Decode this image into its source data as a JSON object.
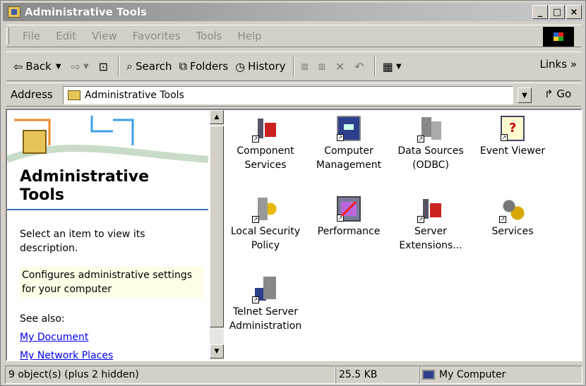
{
  "window": {
    "title": "Administrative Tools",
    "controls": [
      "_",
      "□",
      "×"
    ]
  },
  "menu": [
    "File",
    "Edit",
    "View",
    "Favorites",
    "Tools",
    "Help"
  ],
  "toolbar": {
    "back": "Back",
    "search": "Search",
    "folders": "Folders",
    "history": "History",
    "links": "Links"
  },
  "address": {
    "label": "Address",
    "value": "Administrative Tools",
    "go": "Go"
  },
  "left_pane": {
    "heading_line1": "Administrative",
    "heading_line2": "Tools",
    "desc_line1": "Select an item to view its",
    "desc_line2": "description.",
    "config_line1": "Configures administrative settings",
    "config_line2": "for your computer",
    "see_also": "See also:",
    "links": [
      "My Document",
      "My Network Places"
    ]
  },
  "items": [
    {
      "line1": "Component",
      "line2": "Services",
      "icon": "component-services-icon"
    },
    {
      "line1": "Computer",
      "line2": "Management",
      "icon": "computer-management-icon"
    },
    {
      "line1": "Data Sources",
      "line2": "(ODBC)",
      "icon": "data-sources-icon"
    },
    {
      "line1": "Event Viewer",
      "line2": "",
      "icon": "event-viewer-icon"
    },
    {
      "line1": "Local Security",
      "line2": "Policy",
      "icon": "local-security-icon"
    },
    {
      "line1": "Performance",
      "line2": "",
      "icon": "performance-icon"
    },
    {
      "line1": "Server",
      "line2": "Extensions...",
      "icon": "server-extensions-icon"
    },
    {
      "line1": "Services",
      "line2": "",
      "icon": "services-icon"
    },
    {
      "line1": "Telnet Server",
      "line2": "Administration",
      "icon": "telnet-server-icon"
    }
  ],
  "status": {
    "objects": "9 object(s) (plus 2 hidden)",
    "size": "25.5 KB",
    "zone": "My Computer"
  }
}
